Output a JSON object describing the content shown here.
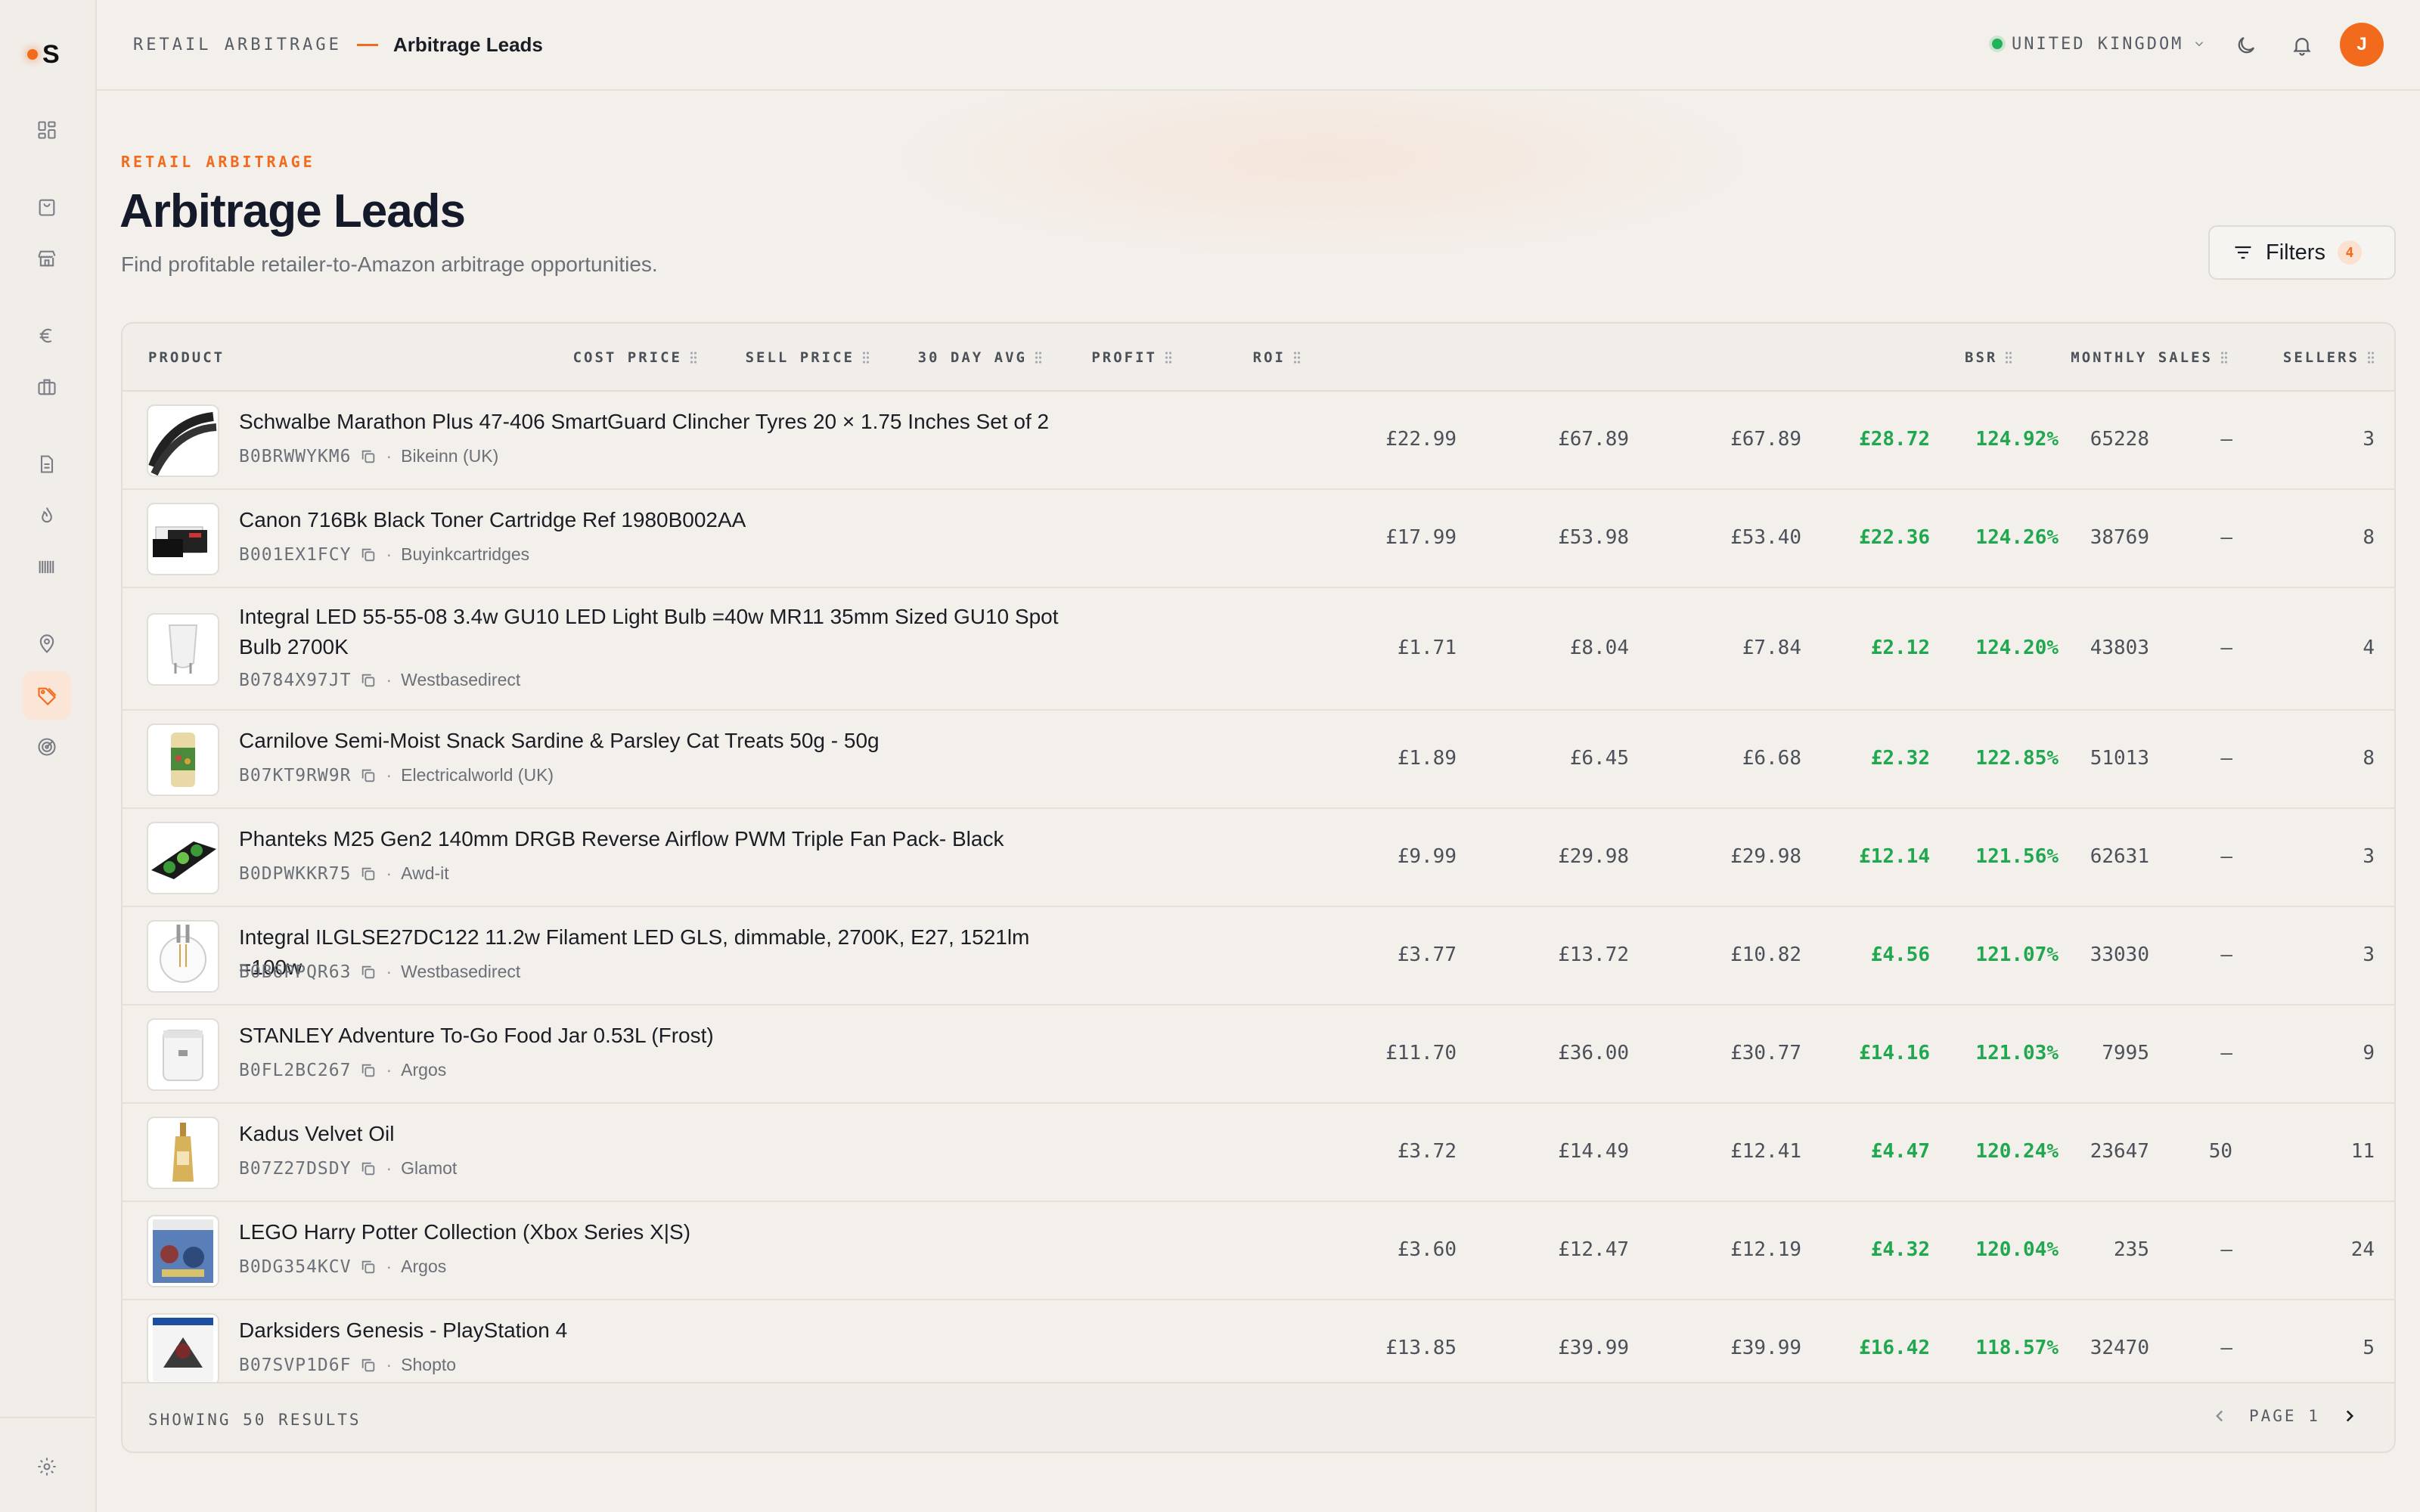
{
  "app": {
    "logo_letter": "S",
    "accent": "#f26b1d",
    "user_initial": "J"
  },
  "sidebar": {
    "items": [
      {
        "icon": "dashboard-icon"
      },
      {
        "icon": "shopping-bag-icon"
      },
      {
        "icon": "store-icon"
      },
      {
        "icon": "euro-icon"
      },
      {
        "icon": "briefcase-icon"
      },
      {
        "icon": "document-icon"
      },
      {
        "icon": "flame-icon"
      },
      {
        "icon": "barcode-icon"
      },
      {
        "icon": "map-pin-icon"
      },
      {
        "icon": "tag-icon",
        "active": true
      },
      {
        "icon": "target-icon"
      }
    ],
    "footer_icon": "settings-icon"
  },
  "topbar": {
    "breadcrumb_root": "RETAIL ARBITRAGE",
    "breadcrumb_current": "Arbitrage Leads",
    "region": "UNITED KINGDOM",
    "region_status_color": "#21b35a"
  },
  "header": {
    "eyebrow": "RETAIL ARBITRAGE",
    "title": "Arbitrage Leads",
    "subtitle": "Find profitable retailer-to-Amazon arbitrage opportunities.",
    "filters_label": "Filters",
    "filters_count": "4"
  },
  "table": {
    "columns": [
      "PRODUCT",
      "COST PRICE",
      "SELL PRICE",
      "30 DAY AVG",
      "PROFIT",
      "ROI",
      "BSR",
      "MONTHLY SALES",
      "SELLERS"
    ],
    "rows": [
      {
        "name": "Schwalbe Marathon Plus 47-406 SmartGuard Clincher Tyres 20 × 1.75 Inches Set of 2",
        "asin": "B0BRWWYKM6",
        "retailer": "Bikeinn (UK)",
        "cost": "£22.99",
        "sell": "£67.89",
        "avg30": "£67.89",
        "profit": "£28.72",
        "roi": "124.92%",
        "bsr": "65228",
        "monthly_sales": "–",
        "sellers": "3"
      },
      {
        "name": "Canon 716Bk Black Toner Cartridge Ref 1980B002AA",
        "asin": "B001EX1FCY",
        "retailer": "Buyinkcartridges",
        "cost": "£17.99",
        "sell": "£53.98",
        "avg30": "£53.40",
        "profit": "£22.36",
        "roi": "124.26%",
        "bsr": "38769",
        "monthly_sales": "–",
        "sellers": "8"
      },
      {
        "name": "Integral LED 55-55-08 3.4w GU10 LED Light Bulb =40w MR11 35mm Sized GU10 Spot Bulb 2700K",
        "asin": "B0784X97JT",
        "retailer": "Westbasedirect",
        "cost": "£1.71",
        "sell": "£8.04",
        "avg30": "£7.84",
        "profit": "£2.12",
        "roi": "124.20%",
        "bsr": "43803",
        "monthly_sales": "–",
        "sellers": "4"
      },
      {
        "name": "Carnilove Semi-Moist Snack Sardine & Parsley Cat Treats 50g - 50g",
        "asin": "B07KT9RW9R",
        "retailer": "Electricalworld (UK)",
        "cost": "£1.89",
        "sell": "£6.45",
        "avg30": "£6.68",
        "profit": "£2.32",
        "roi": "122.85%",
        "bsr": "51013",
        "monthly_sales": "–",
        "sellers": "8"
      },
      {
        "name": "Phanteks M25 Gen2 140mm DRGB Reverse Airflow PWM Triple Fan Pack- Black",
        "asin": "B0DPWKKR75",
        "retailer": "Awd-it",
        "cost": "£9.99",
        "sell": "£29.98",
        "avg30": "£29.98",
        "profit": "£12.14",
        "roi": "121.56%",
        "bsr": "62631",
        "monthly_sales": "–",
        "sellers": "3"
      },
      {
        "name": "Integral ILGLSE27DC122 11.2w Filament LED GLS, dimmable, 2700K, E27, 1521lm =100w",
        "asin": "B0B6PPQR63",
        "retailer": "Westbasedirect",
        "cost": "£3.77",
        "sell": "£13.72",
        "avg30": "£10.82",
        "profit": "£4.56",
        "roi": "121.07%",
        "bsr": "33030",
        "monthly_sales": "–",
        "sellers": "3"
      },
      {
        "name": "STANLEY Adventure To-Go Food Jar 0.53L (Frost)",
        "asin": "B0FL2BC267",
        "retailer": "Argos",
        "cost": "£11.70",
        "sell": "£36.00",
        "avg30": "£30.77",
        "profit": "£14.16",
        "roi": "121.03%",
        "bsr": "7995",
        "monthly_sales": "–",
        "sellers": "9"
      },
      {
        "name": "Kadus Velvet Oil",
        "asin": "B07Z27DSDY",
        "retailer": "Glamot",
        "cost": "£3.72",
        "sell": "£14.49",
        "avg30": "£12.41",
        "profit": "£4.47",
        "roi": "120.24%",
        "bsr": "23647",
        "monthly_sales": "50",
        "sellers": "11"
      },
      {
        "name": "LEGO Harry Potter Collection (Xbox Series X|S)",
        "asin": "B0DG354KCV",
        "retailer": "Argos",
        "cost": "£3.60",
        "sell": "£12.47",
        "avg30": "£12.19",
        "profit": "£4.32",
        "roi": "120.04%",
        "bsr": "235",
        "monthly_sales": "–",
        "sellers": "24"
      },
      {
        "name": "Darksiders Genesis - PlayStation 4",
        "asin": "B07SVP1D6F",
        "retailer": "Shopto",
        "cost": "£13.85",
        "sell": "£39.99",
        "avg30": "£39.99",
        "profit": "£16.42",
        "roi": "118.57%",
        "bsr": "32470",
        "monthly_sales": "–",
        "sellers": "5"
      }
    ],
    "footer_text": "SHOWING 50 RESULTS",
    "page_label": "PAGE 1"
  }
}
